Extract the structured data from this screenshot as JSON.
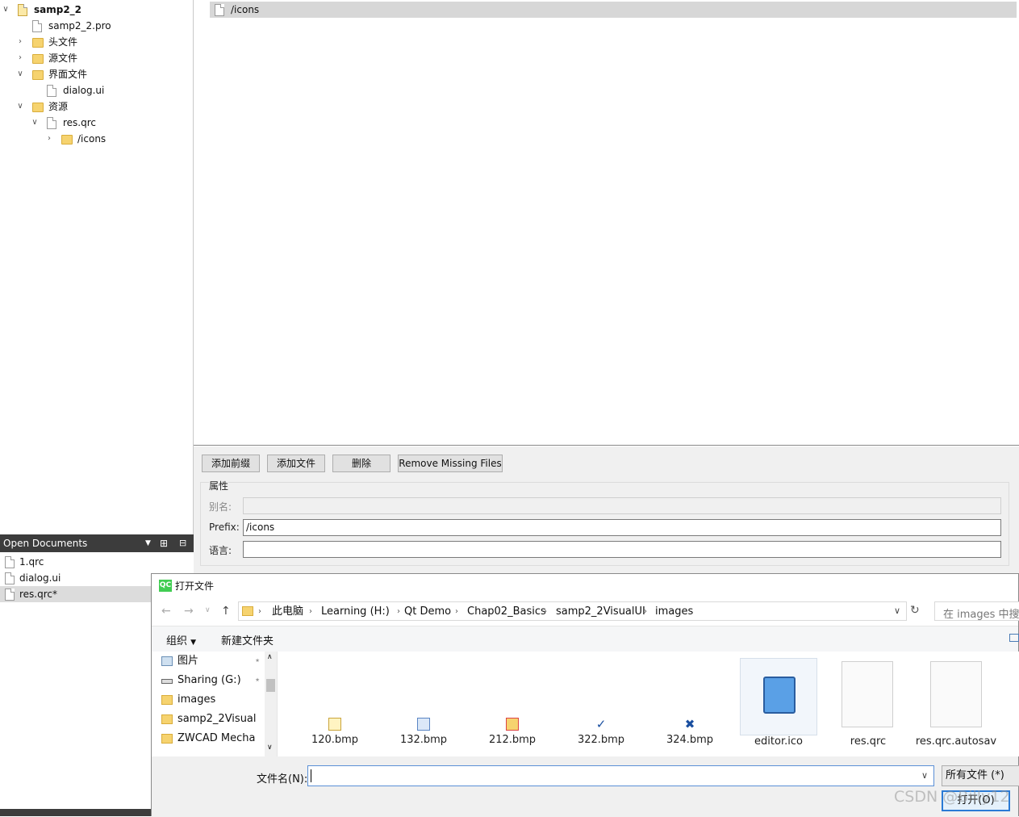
{
  "project_tree": {
    "root": "samp2_2",
    "items": [
      {
        "label": "samp2_2.pro"
      },
      {
        "label": "头文件"
      },
      {
        "label": "源文件"
      },
      {
        "label": "界面文件"
      },
      {
        "label": "dialog.ui"
      },
      {
        "label": "资源"
      },
      {
        "label": "res.qrc"
      },
      {
        "label": "/icons"
      }
    ]
  },
  "open_documents": {
    "title": "Open Documents",
    "items": [
      {
        "label": "1.qrc"
      },
      {
        "label": "dialog.ui"
      },
      {
        "label": "res.qrc*"
      }
    ]
  },
  "resource_editor": {
    "prefix_row": "/icons",
    "buttons": {
      "add_prefix": "添加前缀",
      "add_files": "添加文件",
      "delete": "删除",
      "remove_missing": "Remove Missing Files"
    },
    "properties": {
      "group_title": "属性",
      "alias_label": "别名:",
      "alias_value": "",
      "prefix_label": "Prefix:",
      "prefix_value": "/icons",
      "language_label": "语言:",
      "language_value": ""
    }
  },
  "dialog": {
    "title": "打开文件",
    "breadcrumbs": [
      "此电脑",
      "Learning (H:)",
      "Qt Demo",
      "Chap02_Basics",
      "samp2_2VisualUI",
      "images"
    ],
    "search_placeholder": "在 images 中搜索",
    "toolbar": {
      "organize": "组织",
      "new_folder": "新建文件夹"
    },
    "nav_items": [
      {
        "label": "图片"
      },
      {
        "label": "Sharing (G:)"
      },
      {
        "label": "images"
      },
      {
        "label": "samp2_2Visual"
      },
      {
        "label": "ZWCAD Mecha"
      }
    ],
    "files": [
      {
        "label": "120.bmp"
      },
      {
        "label": "132.bmp"
      },
      {
        "label": "212.bmp"
      },
      {
        "label": "322.bmp"
      },
      {
        "label": "324.bmp"
      },
      {
        "label": "editor.ico"
      },
      {
        "label": "res.qrc"
      },
      {
        "label": "res.qrc.autosav"
      }
    ],
    "filename_label": "文件名(N):",
    "filename_value": "",
    "filter": "所有文件 (*)",
    "open_button": "打开(O)"
  },
  "watermark": "CSDN @Billy12"
}
